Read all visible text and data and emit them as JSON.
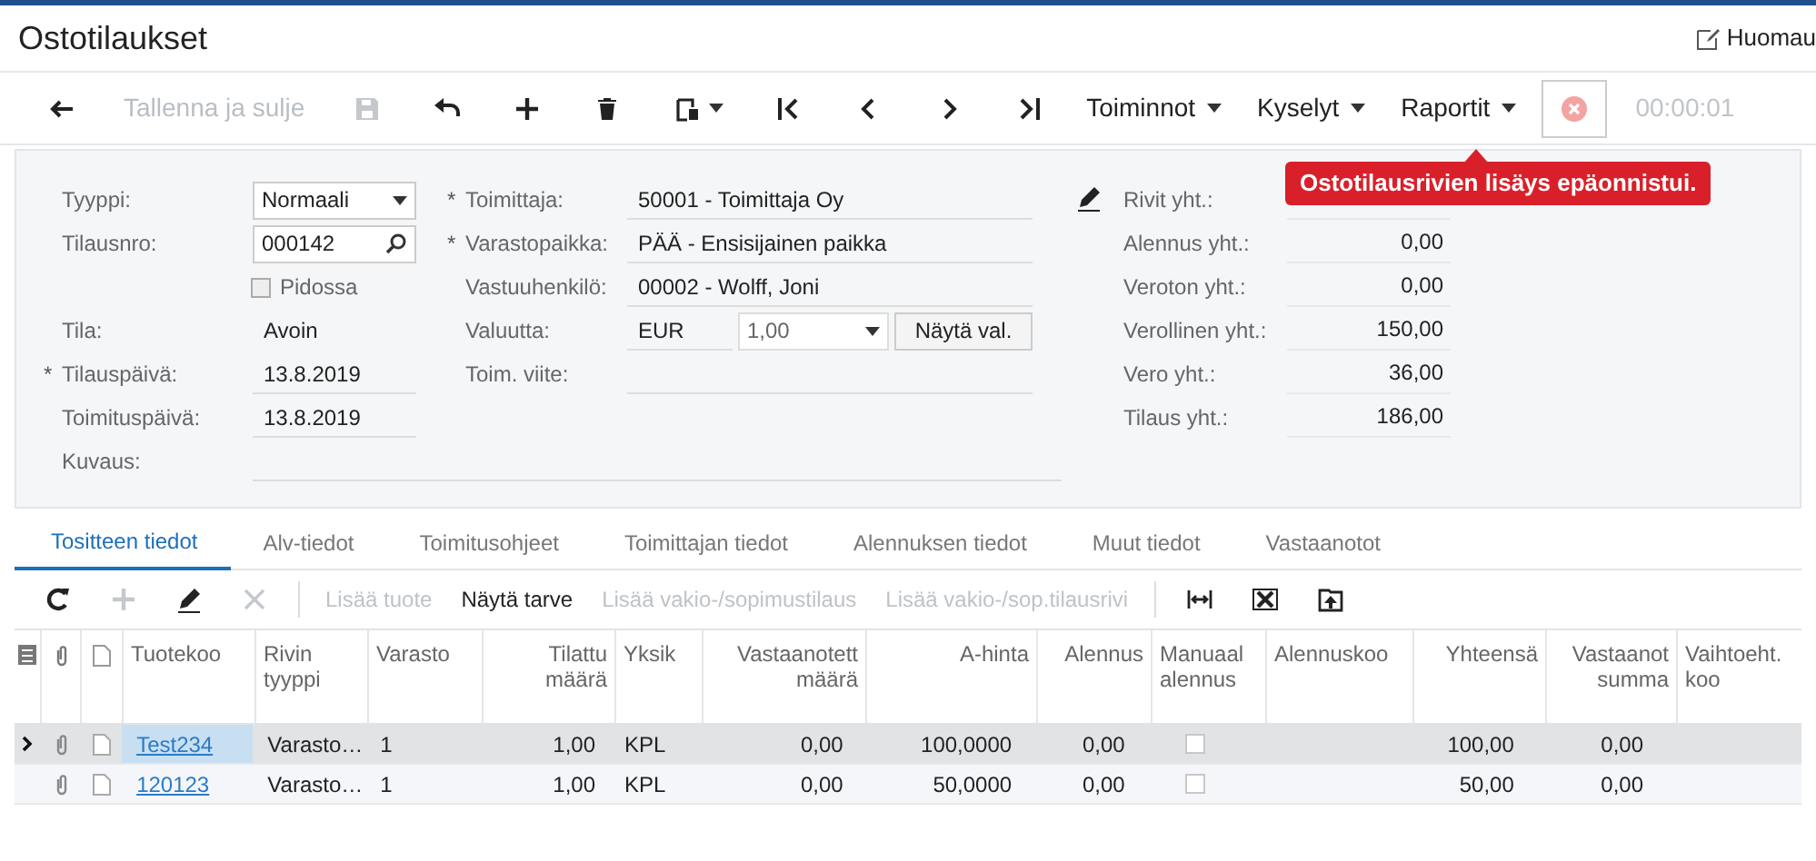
{
  "header": {
    "title": "Ostotilaukset",
    "notes_link": "Huomau"
  },
  "toolbar": {
    "items": [
      {
        "kind": "icon",
        "disabled": false
      },
      {
        "kind": "text",
        "label": "Tallenna ja sulje",
        "disabled": true
      },
      {
        "kind": "icon",
        "disabled": true
      },
      {
        "kind": "icon",
        "disabled": false
      },
      {
        "kind": "icon",
        "disabled": false
      },
      {
        "kind": "icon",
        "disabled": false
      },
      {
        "kind": "icon",
        "disabled": false
      },
      {
        "kind": "icon",
        "disabled": false
      },
      {
        "kind": "icon",
        "disabled": false
      },
      {
        "kind": "icon",
        "disabled": false
      },
      {
        "kind": "icon",
        "disabled": false
      },
      {
        "kind": "menu",
        "label": "Toiminnot",
        "disabled": false
      },
      {
        "kind": "menu",
        "label": "Kyselyt",
        "disabled": false
      },
      {
        "kind": "menu",
        "label": "Raportit",
        "disabled": false
      },
      {
        "kind": "cancel",
        "disabled": false
      }
    ],
    "timer": "00:00:01",
    "error_tooltip": "Ostotilausrivien lisäys epäonnistui."
  },
  "form": {
    "left": [
      {
        "kind": "select",
        "label": "Tyyppi:",
        "value": "Normaali"
      },
      {
        "kind": "lookup",
        "label": "Tilausnro:",
        "value": "000142"
      },
      {
        "kind": "checkbox",
        "label": "Pidossa",
        "checked": false
      },
      {
        "kind": "text",
        "label": "Tila:",
        "value": "Avoin"
      },
      {
        "kind": "field",
        "label": "Tilauspäivä:",
        "value": "13.8.2019",
        "marker": "*"
      },
      {
        "kind": "field",
        "label": "Toimituspäivä:",
        "value": "13.8.2019"
      }
    ],
    "middle": [
      {
        "kind": "field",
        "label": "Toimittaja:",
        "value": "50001 - Toimittaja Oy",
        "marker": "*"
      },
      {
        "kind": "field",
        "label": "Varastopaikka:",
        "value": "PÄÄ - Ensisijainen paikka",
        "marker": "*"
      },
      {
        "kind": "field",
        "label": "Vastuuhenkilö:",
        "value": "00002 - Wolff, Joni"
      },
      {
        "kind": "currency",
        "label": "Valuutta:",
        "value": "EUR",
        "rate": "1,00",
        "button": "Näytä val."
      },
      {
        "kind": "field",
        "label": "Toim. viite:"
      }
    ],
    "description": {
      "label": "Kuvaus:"
    },
    "totals": [
      {
        "label": "Rivit yht.:"
      },
      {
        "label": "Alennus yht.:",
        "value": "0,00"
      },
      {
        "label": "Veroton yht.:",
        "value": "0,00"
      },
      {
        "label": "Verollinen yht.:",
        "value": "150,00"
      },
      {
        "label": "Vero yht.:",
        "value": "36,00"
      },
      {
        "label": "Tilaus yht.:",
        "value": "186,00"
      }
    ]
  },
  "tabs": [
    {
      "label": "Tositteen tiedot",
      "selected": true
    },
    {
      "label": "Alv-tiedot",
      "selected": false
    },
    {
      "label": "Toimitusohjeet",
      "selected": false
    },
    {
      "label": "Toimittajan tiedot",
      "selected": false
    },
    {
      "label": "Alennuksen tiedot",
      "selected": false
    },
    {
      "label": "Muut tiedot",
      "selected": false
    },
    {
      "label": "Vastaanotot",
      "selected": false
    }
  ],
  "grid_toolbar": [
    {
      "kind": "icon",
      "disabled": false
    },
    {
      "kind": "icon",
      "disabled": true
    },
    {
      "kind": "icon",
      "disabled": false
    },
    {
      "kind": "icon",
      "disabled": true
    },
    {
      "kind": "separator"
    },
    {
      "kind": "text",
      "label": "Lisää tuote",
      "disabled": true
    },
    {
      "kind": "text",
      "label": "Näytä tarve",
      "disabled": false
    },
    {
      "kind": "text",
      "label": "Lisää vakio-/sopimustilaus",
      "disabled": true
    },
    {
      "kind": "text",
      "label": "Lisää vakio-/sop.tilausrivi",
      "disabled": true
    },
    {
      "kind": "separator"
    },
    {
      "kind": "icon",
      "disabled": false
    },
    {
      "kind": "icon",
      "disabled": false
    },
    {
      "kind": "icon",
      "disabled": false
    }
  ],
  "table": {
    "columns": [
      {
        "label": "Tuotekoo"
      },
      {
        "label": "Rivin tyyppi"
      },
      {
        "label": "Varasto"
      },
      {
        "label": "Tilattu määrä"
      },
      {
        "label": "Yksik"
      },
      {
        "label": "Vastaanotett määrä"
      },
      {
        "label": "A-hinta"
      },
      {
        "label": "Alennus"
      },
      {
        "label": "Manuaal alennus"
      },
      {
        "label": "Alennuskoo"
      },
      {
        "label": "Yhteensä"
      },
      {
        "label": "Vastaanot summa"
      },
      {
        "label": "Vaihtoeht. koo"
      }
    ],
    "rows": [
      {
        "selected": true,
        "product": "Test234",
        "type": "Varasto…",
        "warehouse": "1",
        "ordered": "1,00",
        "unit": "KPL",
        "received": "0,00",
        "price": "100,0000",
        "discount": "0,00",
        "manual_discount": false,
        "total": "100,00",
        "received_sum": "0,00"
      },
      {
        "selected": false,
        "product": "120123",
        "type": "Varasto…",
        "warehouse": "1",
        "ordered": "1,00",
        "unit": "KPL",
        "received": "0,00",
        "price": "50,0000",
        "discount": "0,00",
        "manual_discount": false,
        "total": "50,00",
        "received_sum": "0,00"
      }
    ]
  }
}
